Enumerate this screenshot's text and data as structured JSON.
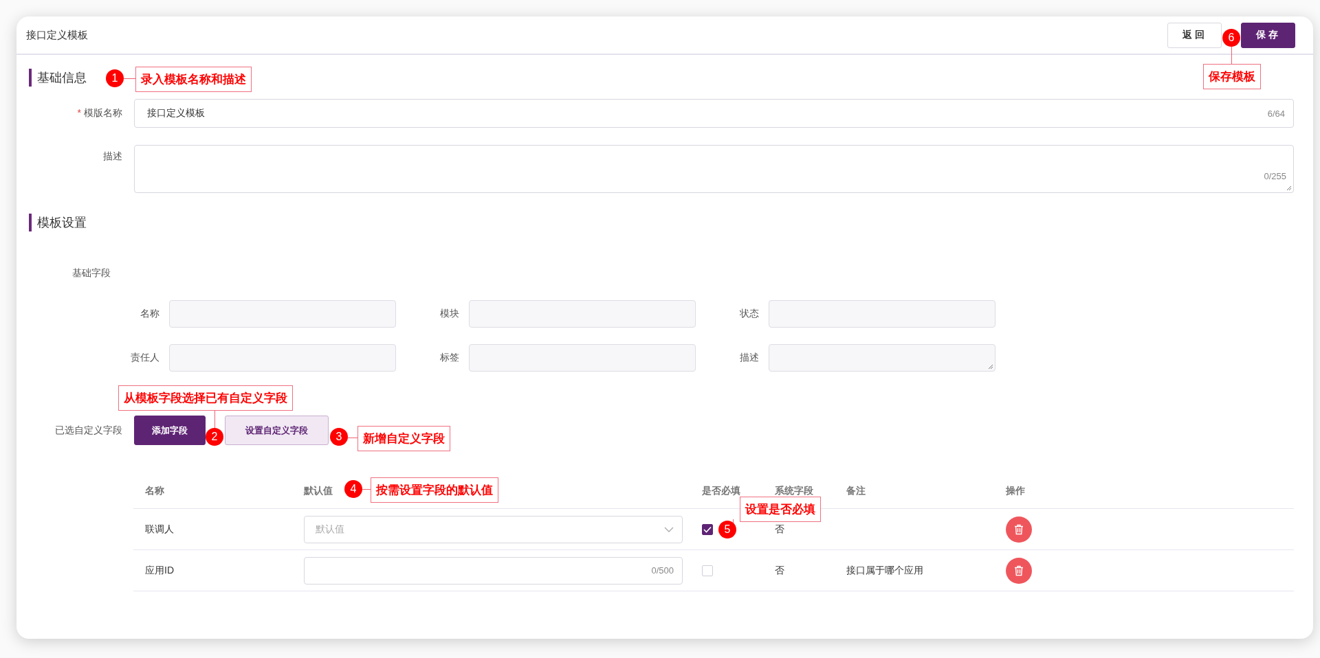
{
  "header": {
    "title": "接口定义模板",
    "buttons": [
      {
        "label": "返回",
        "kind": "default"
      },
      {
        "label": "保存",
        "kind": "primary"
      }
    ]
  },
  "basic_info": {
    "title": "基础信息",
    "name_field": {
      "label": "模版名称",
      "required_mark": "*",
      "value": "接口定义模板",
      "counter": "6/64"
    },
    "description_field": {
      "label": "描述",
      "counter": "0/255"
    }
  },
  "template_settings": {
    "title": "模板设置",
    "base_fields_label": "基础字段",
    "base_fields": [
      {
        "label": "名称",
        "kind": "input"
      },
      {
        "label": "模块",
        "kind": "input"
      },
      {
        "label": "状态",
        "kind": "input"
      },
      {
        "label": "责任人",
        "kind": "input"
      },
      {
        "label": "标签",
        "kind": "input"
      },
      {
        "label": "描述",
        "kind": "textarea"
      }
    ],
    "custom_fields_label": "已选自定义字段",
    "buttons": [
      {
        "label": "添加字段",
        "kind": "primary"
      },
      {
        "label": "设置自定义字段",
        "kind": "secondary"
      }
    ],
    "table": {
      "columns": [
        "名称",
        "默认值",
        "是否必填",
        "系统字段",
        "备注",
        "操作"
      ],
      "rows": [
        {
          "name": "联调人",
          "default": {
            "kind": "select",
            "placeholder": "默认值"
          },
          "required": true,
          "system": "否"
        },
        {
          "name": "应用ID",
          "default": {
            "kind": "input",
            "counter": "0/500"
          },
          "required": false,
          "system": "否",
          "note": "接口属于哪个应用"
        }
      ]
    }
  },
  "annotations": [
    {
      "number": "1",
      "text": "录入模板名称和描述"
    },
    {
      "number": "2",
      "text": "从模板字段选择已有自定义字段"
    },
    {
      "number": "3",
      "text": "新增自定义字段"
    },
    {
      "number": "4",
      "text": "按需设置字段的默认值"
    },
    {
      "number": "5",
      "text": "设置是否必填"
    },
    {
      "number": "6",
      "text": "保存模板"
    }
  ]
}
